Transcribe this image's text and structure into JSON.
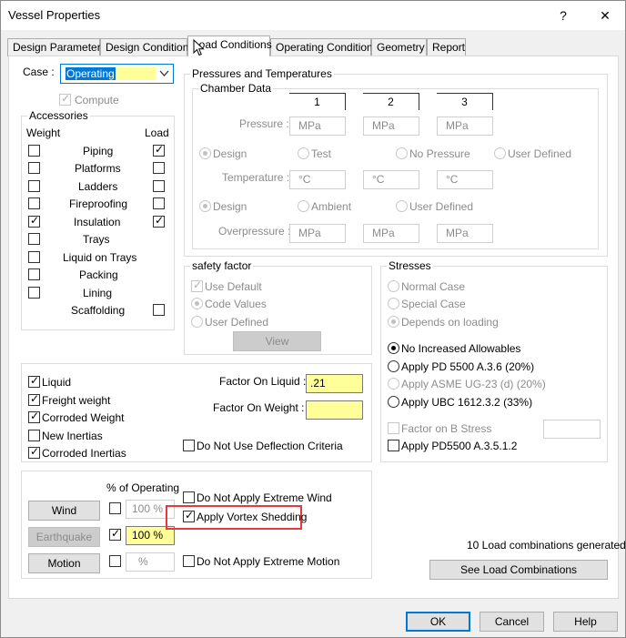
{
  "window": {
    "title": "Vessel Properties",
    "help_glyph": "?",
    "close_glyph": "✕"
  },
  "tabs": [
    "Design Parameters",
    "Design Conditions",
    "Load Conditions",
    "Operating Conditions",
    "Geometry",
    "Report"
  ],
  "case": {
    "label": "Case :",
    "value": "Operating",
    "compute_label": "Compute"
  },
  "accessories": {
    "title": "Accessories",
    "weight_header": "Weight",
    "load_header": "Load",
    "items": [
      {
        "label": "Piping",
        "weight": false,
        "load": true
      },
      {
        "label": "Platforms",
        "weight": false,
        "load": false
      },
      {
        "label": "Ladders",
        "weight": false,
        "load": false
      },
      {
        "label": "Fireproofing",
        "weight": false,
        "load": false
      },
      {
        "label": "Insulation",
        "weight": true,
        "load": true
      },
      {
        "label": "Trays",
        "weight": false
      },
      {
        "label": "Liquid on Trays",
        "weight": false
      },
      {
        "label": "Packing",
        "weight": false
      },
      {
        "label": "Lining",
        "weight": false
      },
      {
        "label": "Scaffolding",
        "load": false
      }
    ]
  },
  "pressures": {
    "title": "Pressures and Temperatures",
    "chamber": {
      "title": "Chamber Data",
      "columns": [
        "1",
        "2",
        "3"
      ],
      "pressure_label": "Pressure :",
      "pressure_unit": "MPa",
      "pressure_options": [
        "Design",
        "Test",
        "No Pressure",
        "User Defined"
      ],
      "temperature_label": "Temperature :",
      "temperature_unit": "°C",
      "temperature_options": [
        "Design",
        "Ambient",
        "User Defined"
      ],
      "overpressure_label": "Overpressure :",
      "overpressure_unit": "MPa"
    }
  },
  "safety": {
    "title": "safety factor",
    "use_default": "Use Default",
    "code_values": "Code Values",
    "user_defined": "User Defined",
    "view_button": "View"
  },
  "stresses": {
    "title": "Stresses",
    "normal_case": "Normal Case",
    "special_case": "Special Case",
    "depends": "Depends on loading",
    "no_increased": "No Increased Allowables",
    "pd5500": "Apply PD 5500 A.3.6 (20%)",
    "asme": "Apply ASME UG-23 (d) (20%)",
    "ubc": "Apply UBC 1612.3.2 (33%)",
    "factor_b": "Factor on B Stress",
    "pd5500_a35": "Apply PD5500 A.3.5.1.2"
  },
  "weights": {
    "liquid": "Liquid",
    "freight": "Freight weight",
    "corroded": "Corroded Weight",
    "new_inertias": "New Inertias",
    "corroded_inertias": "Corroded Inertias",
    "factor_liquid_label": "Factor On Liquid :",
    "factor_liquid_value": ".21",
    "factor_weight_label": "Factor On Weight :",
    "factor_weight_value": "",
    "no_deflection": "Do Not Use Deflection Criteria"
  },
  "loads": {
    "percent_header": "% of Operating",
    "wind_button": "Wind",
    "wind_value": "100 %",
    "earthquake_button": "Earthquake",
    "earthquake_value": "100 %",
    "motion_button": "Motion",
    "motion_value": "%",
    "no_extreme_wind": "Do Not Apply Extreme Wind",
    "vortex": "Apply Vortex Shedding",
    "no_extreme_motion": "Do Not Apply Extreme Motion"
  },
  "combinations": {
    "generated_text": "10 Load combinations generated",
    "see_button": "See Load Combinations"
  },
  "footer": {
    "ok": "OK",
    "cancel": "Cancel",
    "help": "Help"
  },
  "colors": {
    "highlight_border": "#e8393a",
    "field_yellow": "#ffff99",
    "ok_border": "#0078d7"
  }
}
